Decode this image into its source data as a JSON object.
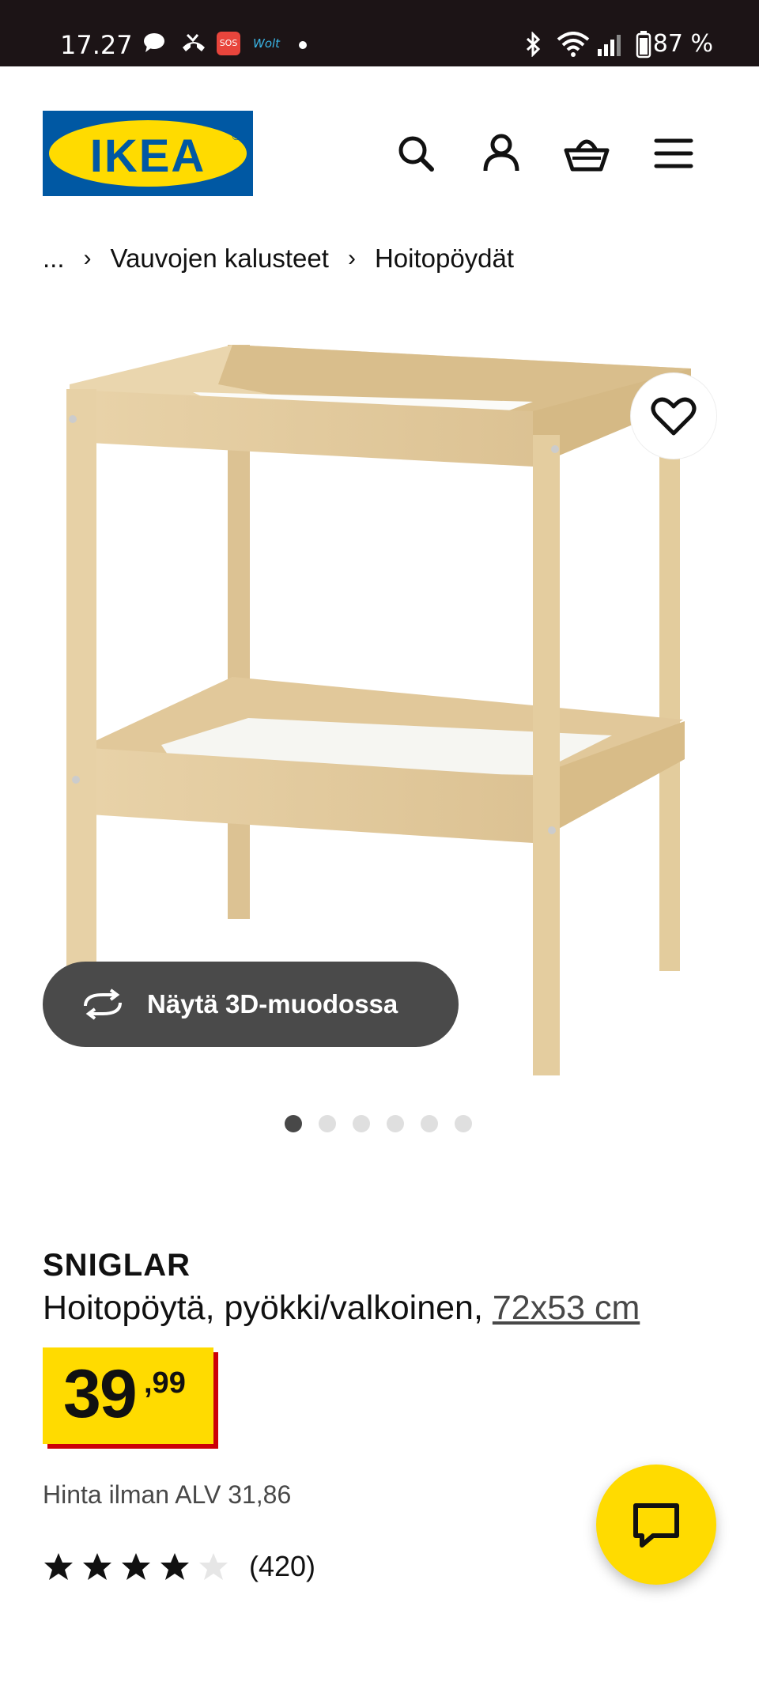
{
  "status_bar": {
    "time": "17.27",
    "battery": "87 %",
    "app_badges": [
      "SOS",
      "Wolt"
    ]
  },
  "header": {
    "logo_text": "IKEA",
    "icons": [
      "search-icon",
      "account-icon",
      "basket-icon",
      "menu-icon"
    ]
  },
  "breadcrumb": {
    "ellipsis": "...",
    "items": [
      "Vauvojen kalusteet",
      "Hoitopöydät"
    ]
  },
  "gallery": {
    "view_3d_label": "Näytä 3D-muodossa",
    "image_count": 6,
    "active_index": 0
  },
  "product": {
    "name": "SNIGLAR",
    "description": "Hoitopöytä, pyökki/valkoinen, ",
    "size_link": "72x53 cm",
    "price_main": "39",
    "price_decimals": ",99",
    "vat_text": "Hinta ilman ALV 31,86",
    "rating": 4,
    "rating_max": 5,
    "review_count": "(420)"
  },
  "colors": {
    "brand_blue": "#0058a3",
    "brand_yellow": "#ffdb00",
    "price_shadow": "#cc0008"
  }
}
